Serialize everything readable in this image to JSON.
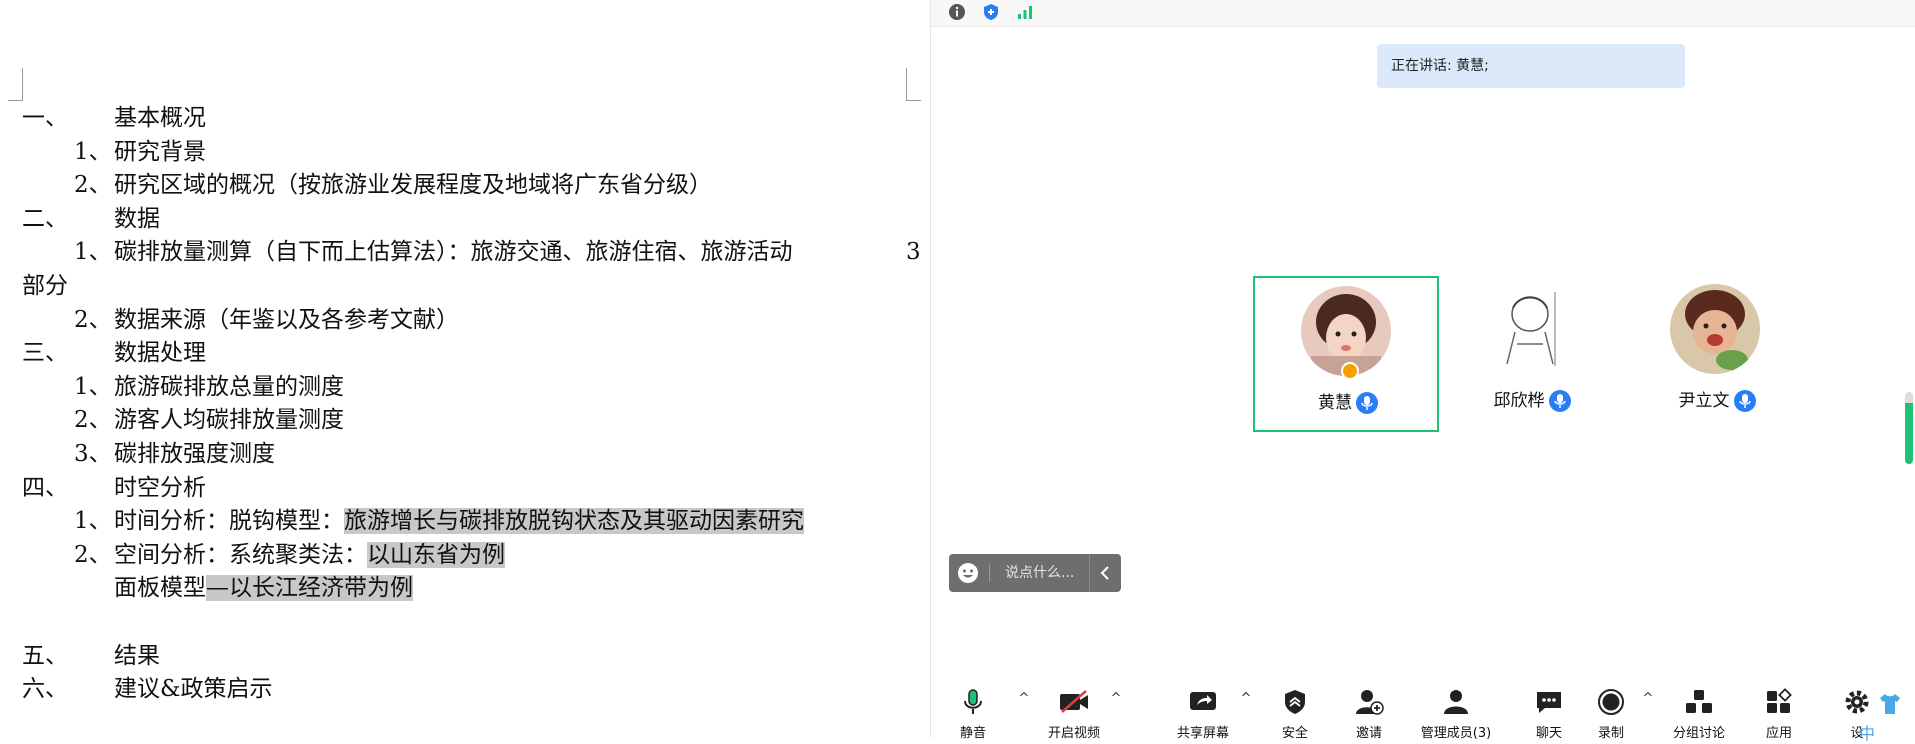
{
  "document": {
    "lines": [
      {
        "num": "一、",
        "text": "基本概况"
      },
      {
        "num": "1、",
        "text": "研究背景"
      },
      {
        "num": "2、",
        "text": "研究区域的概况（按旅游业发展程度及地域将广东省分级）"
      },
      {
        "num": "二、",
        "text": "数据"
      },
      {
        "num": "1、",
        "text": "碳排放量测算（自下而上估算法）：旅游交通、旅游住宿、旅游活动",
        "wrap_end": "3"
      },
      {
        "num": "",
        "text": "部分"
      },
      {
        "num": "2、",
        "text": "数据来源（年鉴以及各参考文献）"
      },
      {
        "num": "三、",
        "text": "数据处理"
      },
      {
        "num": "1、",
        "text": "旅游碳排放总量的测度"
      },
      {
        "num": "2、",
        "text": "游客人均碳排放量测度"
      },
      {
        "num": "3、",
        "text": "碳排放强度测度"
      },
      {
        "num": "四、",
        "text": "时空分析"
      },
      {
        "num": "1、",
        "text": "时间分析：脱钩模型：",
        "hl": "旅游增长与碳排放脱钩状态及其驱动因素研究"
      },
      {
        "num": "2、",
        "text": "空间分析：系统聚类法：",
        "hl": "以山东省为例"
      },
      {
        "num": "",
        "text": "面板模型",
        "hl": "—以长江经济带为例"
      },
      {
        "num": "",
        "text": ""
      },
      {
        "num": "五、",
        "text": "结果"
      },
      {
        "num": "六、",
        "text": "建议&政策启示"
      }
    ]
  },
  "meeting": {
    "speaking_label": "正在讲话: 黄慧;",
    "participants": [
      {
        "name": "黄慧",
        "active": true,
        "host": true
      },
      {
        "name": "邱欣桦",
        "active": false,
        "host": false
      },
      {
        "name": "尹立文",
        "active": false,
        "host": false
      }
    ],
    "chat_placeholder": "说点什么...",
    "volume_level": 0.85,
    "toolbar": {
      "mute": "静音",
      "video": "开启视频",
      "share": "共享屏幕",
      "security": "安全",
      "invite": "邀请",
      "members": "管理成员(3)",
      "chat": "聊天",
      "record": "录制",
      "breakout": "分组讨论",
      "apps": "应用",
      "settings": "设"
    },
    "colors": {
      "active_border": "#1ec274",
      "speaking_bg": "#dbe9fb",
      "mic_blue": "#2a7df4",
      "highlight": "#c8c8c8"
    }
  }
}
